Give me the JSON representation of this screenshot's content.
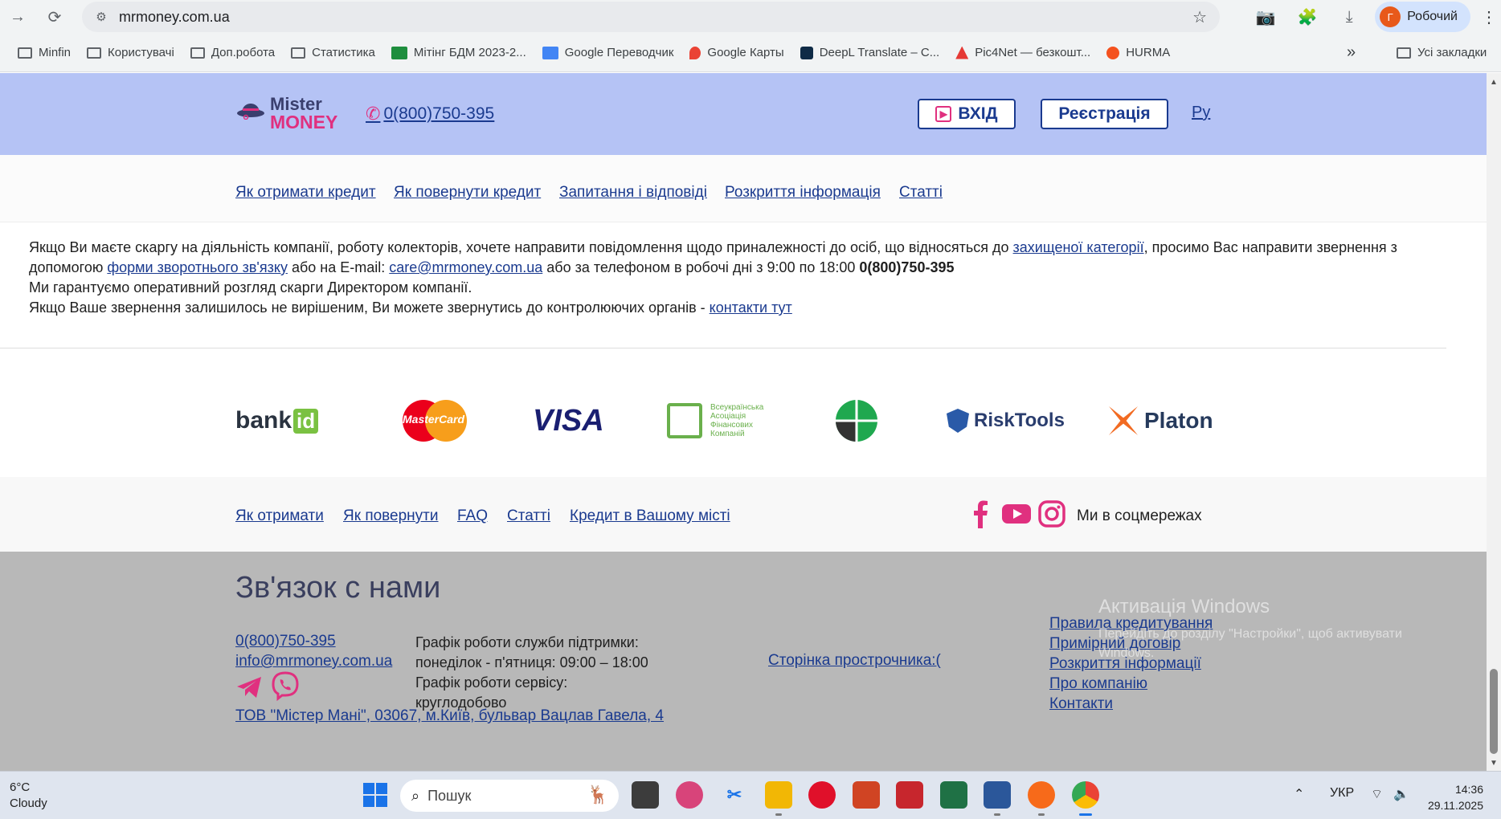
{
  "browser": {
    "url": "mrmoney.com.ua",
    "profile_initial": "Г",
    "profile_name": "Робочий",
    "bookmarks": [
      "Minfin",
      "Користувачі",
      "Доп.робота",
      "Статистика",
      "Мітінг БДМ 2023-2...",
      "Google Переводчик",
      "Google Карты",
      "DeepL Translate – С...",
      "Pic4Net — безкошт...",
      "HURMA"
    ],
    "more": "»",
    "all_bookmarks": "Усі закладки"
  },
  "header": {
    "logo_top": "Mister",
    "logo_bottom": "MONEY",
    "phone": "0(800)750-395",
    "login": "ВХІД",
    "register": "Реєстрація",
    "lang": "Ру"
  },
  "nav": [
    "Як отримати кредит",
    "Як повернути кредит",
    "Запитання і відповіді",
    "Розкриття інформація",
    "Статті"
  ],
  "complaint": {
    "p1_a": "Якщо Ви маєте скаргу на діяльність компанії, роботу колекторів, хочете направити повідомлення щодо приналежності до осіб, що відносяться до ",
    "p1_link": "захищеної категорії",
    "p1_b": ", просимо Вас направити звернення з допомогою ",
    "p1_link2": "форми зворотнього зв'язку",
    "p1_c": " або на E-mail: ",
    "p1_email": "care@mrmoney.com.ua",
    "p1_d": " або за телефоном в робочі дні з 9:00 по 18:00 ",
    "p1_phone": "0(800)750-395",
    "p2": "Ми гарантуємо оперативний розгляд скарги Директором компанії.",
    "p3_a": "Якщо Ваше звернення залишилось не вирішеним, Ви можете звернутись до контролюючих органів - ",
    "p3_link": "контакти тут"
  },
  "partners": {
    "bankid_a": "bank",
    "bankid_b": "id",
    "mastercard": "MasterCard",
    "visa": "VISA",
    "association": [
      "Всеукраїнська",
      "Асоціація",
      "Фінансових",
      "Компаній"
    ],
    "risktools": "RiskTools",
    "platon": "Platon"
  },
  "footer_nav": [
    "Як отримати",
    "Як повернути",
    "FAQ",
    "Статті",
    "Кредит в Вашому місті"
  ],
  "social_label": "Ми в соцмережах",
  "contact": {
    "title": "Зв'язок с нами",
    "phone": "0(800)750-395",
    "email": "info@mrmoney.com.ua",
    "schedule": [
      "Графік роботи служби підтримки:",
      "понеділок - п'ятниця: 09:00 – 18:00",
      "Графік роботи сервісу:",
      "круглодобово"
    ],
    "overdue": "Сторінка прострочника:(",
    "links": [
      "Правила кредитування",
      "Примірний договір",
      "Розкриття інформації",
      "Про компанію",
      "Контакти"
    ],
    "company": "ТОВ \"Містер Мані\", 03067, м.Київ, бульвар Вацлав Гавела, 4"
  },
  "watermark": {
    "title": "Активація Windows",
    "text": "Перейдіть до розділу \"Настройки\", щоб активувати Windows."
  },
  "taskbar": {
    "temp": "6°C",
    "weather": "Cloudy",
    "search_placeholder": "Пошук",
    "lang": "УКР",
    "time": "14:36",
    "date": "29.11.2025"
  },
  "colors": {
    "hero_bg": "#b5c3f5",
    "brand_pink": "#e0307f",
    "link_blue": "#1a3a8f",
    "contact_bg": "#b8b8b8"
  }
}
